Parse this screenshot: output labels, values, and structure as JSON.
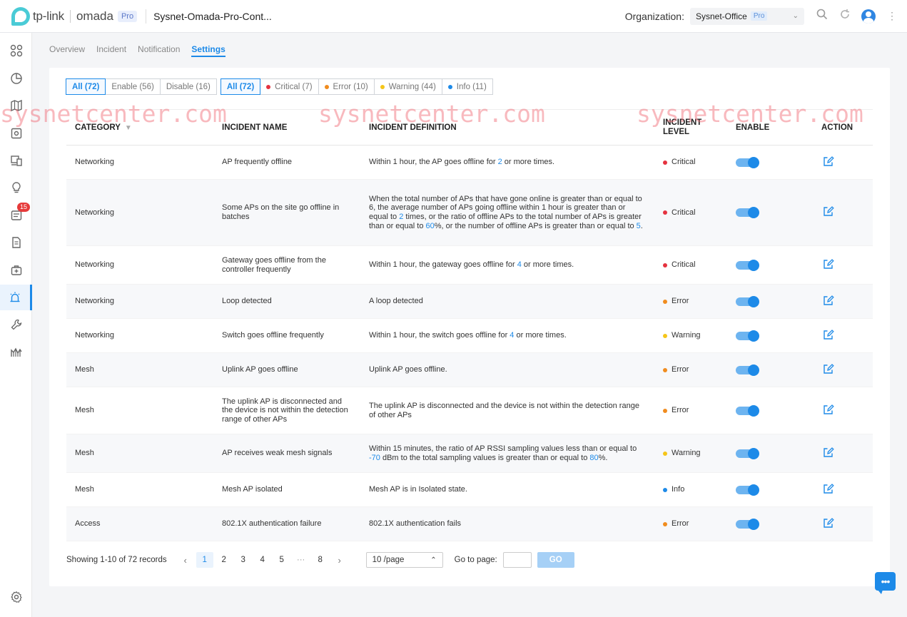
{
  "brand": {
    "tplink": "tp-link",
    "omada": "omada",
    "pro": "Pro"
  },
  "header": {
    "app_title": "Sysnet-Omada-Pro-Cont...",
    "org_label": "Organization:",
    "org_value": "Sysnet-Office",
    "org_pro": "Pro"
  },
  "sidebar": {
    "badge": "15",
    "items": [
      "dashboard-icon",
      "statistics-icon",
      "map-icon",
      "devices-icon",
      "clients-icon",
      "insights-icon",
      "logs-icon",
      "reports-icon",
      "tools-icon",
      "alerts-icon",
      "maintenance-icon",
      "analytics-icon",
      "settings-icon"
    ]
  },
  "subtabs": [
    "Overview",
    "Incident",
    "Notification",
    "Settings"
  ],
  "filters": {
    "status": [
      "All (72)",
      "Enable (56)",
      "Disable (16)"
    ],
    "levels": [
      "All (72)",
      "Critical (7)",
      "Error (10)",
      "Warning (44)",
      "Info (11)"
    ]
  },
  "watermark": "sysnetcenter.com",
  "table": {
    "headers": {
      "category": "CATEGORY",
      "name": "INCIDENT NAME",
      "definition": "INCIDENT DEFINITION",
      "level_1": "INCIDENT",
      "level_2": "LEVEL",
      "enable": "ENABLE",
      "action": "ACTION"
    },
    "rows": [
      {
        "category": "Networking",
        "name": "AP frequently offline",
        "definition": "Within 1 hour, the AP goes offline for 2 or more times.",
        "level": "Critical"
      },
      {
        "category": "Networking",
        "name": "Some APs on the site go offline in batches",
        "definition": "When the total number of APs that have gone online is greater than or equal to 6, the average number of APs going offline within 1 hour is greater than or equal to 2 times, or the ratio of offline APs to the total number of APs is greater than or equal to 60%, or the number of offline APs is greater than or equal to 5.",
        "level": "Critical"
      },
      {
        "category": "Networking",
        "name": "Gateway goes offline from the controller frequently",
        "definition": "Within 1 hour, the gateway goes offline for 4 or more times.",
        "level": "Critical"
      },
      {
        "category": "Networking",
        "name": "Loop detected",
        "definition": "A loop detected",
        "level": "Error"
      },
      {
        "category": "Networking",
        "name": "Switch goes offline frequently",
        "definition": "Within 1 hour, the switch goes offline for 4 or more times.",
        "level": "Warning"
      },
      {
        "category": "Mesh",
        "name": "Uplink AP goes offline",
        "definition": "Uplink AP goes offline.",
        "level": "Error"
      },
      {
        "category": "Mesh",
        "name": "The uplink AP is disconnected and the device is not within the detection range of other APs",
        "definition": "The uplink AP is disconnected and the device is not within the detection range of other APs",
        "level": "Error"
      },
      {
        "category": "Mesh",
        "name": "AP receives weak mesh signals",
        "definition": "Within 15 minutes, the ratio of AP RSSI sampling values less than or equal to -70 dBm to the total sampling values is greater than or equal to 80%.",
        "level": "Warning"
      },
      {
        "category": "Mesh",
        "name": "Mesh AP isolated",
        "definition": "Mesh AP is in Isolated state.",
        "level": "Info"
      },
      {
        "category": "Access",
        "name": "802.1X authentication failure",
        "definition": "802.1X authentication fails",
        "level": "Error"
      }
    ]
  },
  "level_colors": {
    "Critical": "#e5323f",
    "Error": "#f08c1e",
    "Warning": "#f5c518",
    "Info": "#1d8ae8"
  },
  "pagination": {
    "summary": "Showing 1-10 of 72 records",
    "pages": [
      "1",
      "2",
      "3",
      "4",
      "5",
      "···",
      "8"
    ],
    "current": "1",
    "page_size": "10 /page",
    "goto_label": "Go to page:",
    "go_button": "GO"
  }
}
